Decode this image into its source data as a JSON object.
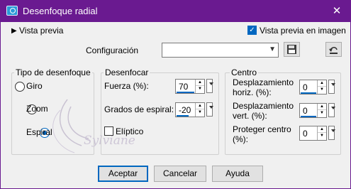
{
  "window": {
    "title": "Desenfoque radial",
    "close_glyph": "✕"
  },
  "preview": {
    "toggle_label": "Vista previa",
    "checkbox_label": "Vista previa en imagen",
    "checked": true
  },
  "config": {
    "label": "Configuración",
    "value": ""
  },
  "blur_type": {
    "legend": "Tipo de desenfoque",
    "options": [
      {
        "label": "Giro",
        "selected": false
      },
      {
        "label": "Zoom",
        "selected": false
      },
      {
        "label": "Espiral",
        "selected": true
      }
    ]
  },
  "blur": {
    "legend": "Desenfocar",
    "strength_label": "Fuerza (%):",
    "strength_value": "70",
    "spiral_label": "Grados de espiral:",
    "spiral_value": "-20",
    "elliptic_label": "Elíptico",
    "elliptic_checked": false
  },
  "center": {
    "legend": "Centro",
    "h_label_1": "Desplazamiento",
    "h_label_2": "horiz. (%):",
    "h_value": "0",
    "v_label_1": "Desplazamiento",
    "v_label_2": "vert. (%):",
    "v_value": "0",
    "p_label_1": "Proteger centro",
    "p_label_2": "(%):",
    "p_value": "0"
  },
  "watermark": "Sylviane",
  "buttons": {
    "ok": "Aceptar",
    "cancel": "Cancelar",
    "help": "Ayuda"
  },
  "colors": {
    "titlebar": "#6a1a90",
    "accent": "#0067c0"
  }
}
